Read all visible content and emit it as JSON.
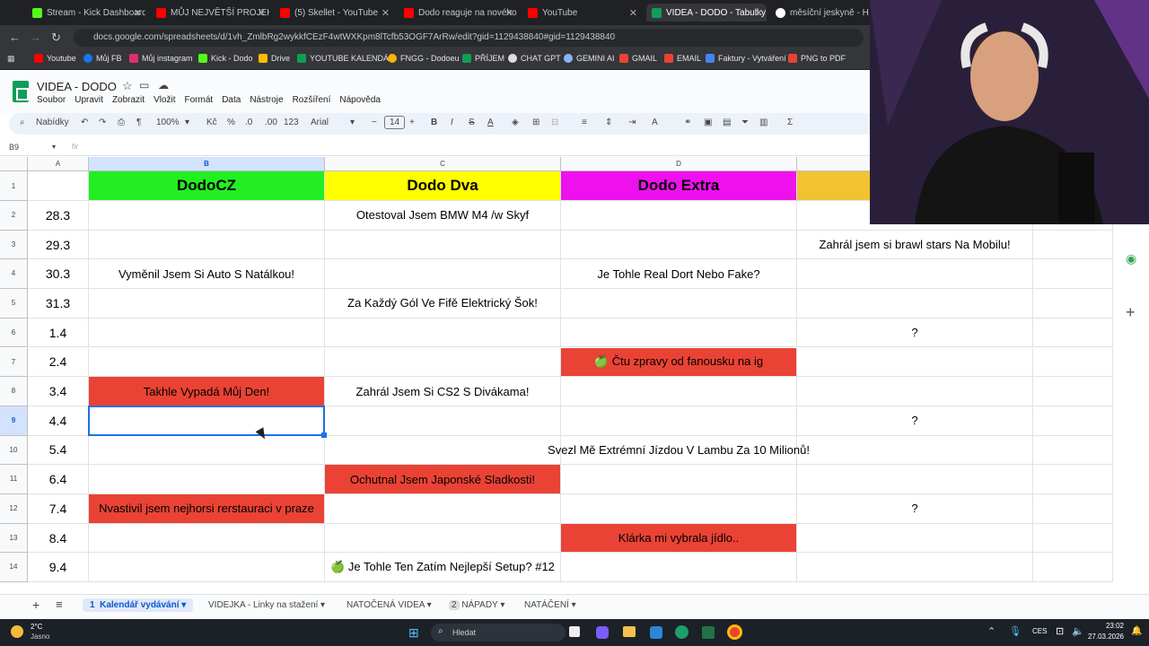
{
  "browser": {
    "tabs": [
      {
        "title": "Stream - Kick Dashboard",
        "color": "#53fc18"
      },
      {
        "title": "MŮJ NEJVĚTŠÍ PROJEKT...",
        "color": "#ff0000"
      },
      {
        "title": "(5) Skellet - YouTube",
        "color": "#ff0000"
      },
      {
        "title": "Dodo reaguje na nového",
        "color": "#ff0000"
      },
      {
        "title": "YouTube",
        "color": "#ff0000"
      },
      {
        "title": "VIDEA - DODO - Tabulky",
        "color": "#0f9d58"
      },
      {
        "title": "měsíční jeskyně - Hledat G",
        "color": "#ffffff"
      }
    ],
    "url": "docs.google.com/spreadsheets/d/1vh_ZmlbRg2wykkfCEzF4wtWXKpm8lTcfb53OGF7ArRw/edit?gid=1129438840#gid=1129438840",
    "bookmarks": [
      "Youtube",
      "Můj FB",
      "Můj instagram",
      "Kick - Dodo",
      "Drive",
      "YOUTUBE KALENDÁŘ",
      "FNGG - Dodoeu",
      "PŘÍJEM",
      "CHAT GPT",
      "GEMINI AI",
      "GMAIL",
      "EMAIL",
      "Faktury - Vytváření",
      "PNG to PDF"
    ]
  },
  "doc": {
    "title": "VIDEA - DODO",
    "menu": [
      "Soubor",
      "Upravit",
      "Zobrazit",
      "Vložit",
      "Formát",
      "Data",
      "Nástroje",
      "Rozšíření",
      "Nápověda"
    ]
  },
  "toolbar": {
    "search_label": "Nabídky",
    "zoom": "100%",
    "currency": "Kč",
    "percent": "%",
    "dec_minus": ".0",
    "dec_plus": ".00",
    "number_format": "123",
    "font": "Arial",
    "font_size": "14"
  },
  "formula_bar": {
    "cell_ref": "B9",
    "fx": "fx"
  },
  "columns": [
    "A",
    "B",
    "C",
    "D"
  ],
  "header_row": {
    "number": "1",
    "b": "DodoCZ",
    "c": "Dodo Dva",
    "d": "Dodo Extra"
  },
  "rows": [
    {
      "n": "2",
      "date": "28.3",
      "b": "",
      "c": "Otestoval Jsem BMW M4 /w Skyf",
      "d": "",
      "e": ""
    },
    {
      "n": "3",
      "date": "29.3",
      "b": "",
      "c": "",
      "d": "",
      "e": "Zahrál jsem si brawl stars Na Mobilu!"
    },
    {
      "n": "4",
      "date": "30.3",
      "b": "Vyměnil Jsem Si Auto S Natálkou!",
      "c": "",
      "d": "Je Tohle Real Dort Nebo Fake?",
      "e": ""
    },
    {
      "n": "5",
      "date": "31.3",
      "b": "",
      "c": "Za Každý Gól Ve Fifě Elektrický Šok!",
      "d": "",
      "e": ""
    },
    {
      "n": "6",
      "date": "1.4",
      "b": "",
      "c": "",
      "d": "",
      "e": "?"
    },
    {
      "n": "7",
      "date": "2.4",
      "b": "",
      "c": "",
      "d": "🍏 Čtu zpravy od fanousku na ig",
      "e": ""
    },
    {
      "n": "8",
      "date": "3.4",
      "b": "Takhle Vypadá Můj Den!",
      "c": "Zahrál Jsem Si CS2 S Divákama!",
      "d": "",
      "e": ""
    },
    {
      "n": "9",
      "date": "4.4",
      "b": "",
      "c": "",
      "d": "",
      "e": "?"
    },
    {
      "n": "10",
      "date": "5.4",
      "b": "",
      "c": "",
      "d": "Svezl Mě Extrémní Jízdou V Lambu Za 10 Milionů!",
      "e": ""
    },
    {
      "n": "11",
      "date": "6.4",
      "b": "",
      "c": "Ochutnal Jsem Japonské Sladkosti!",
      "d": "",
      "e": ""
    },
    {
      "n": "12",
      "date": "7.4",
      "b": "Nvastivil jsem nejhorsi rerstauraci v praze",
      "c": "",
      "d": "",
      "e": "?"
    },
    {
      "n": "13",
      "date": "8.4",
      "b": "",
      "c": "",
      "d": "Klárka mi vybrala jídlo..",
      "e": ""
    },
    {
      "n": "14",
      "date": "9.4",
      "b": "",
      "c": "🍏 Je Tohle Ten Zatím Nejlepší Setup? #12",
      "d": "",
      "e": ""
    }
  ],
  "colors": {
    "green": "#22ee22",
    "yellow": "#ffff00",
    "magenta": "#ee11ee",
    "orange": "#f1c232",
    "red": "#ea4335",
    "selection": "#1a73e8"
  },
  "sheet_tabs": [
    {
      "num": "1",
      "label": "Kalendář vydávání"
    },
    {
      "num": "",
      "label": "VIDEJKA - Linky na stažení"
    },
    {
      "num": "",
      "label": "NATOČENÁ VIDEA"
    },
    {
      "num": "2",
      "label": "NÁPADY"
    },
    {
      "num": "",
      "label": "NATÁČENÍ"
    }
  ],
  "taskbar": {
    "weather_temp": "2°C",
    "weather_desc": "Jasno",
    "search": "Hledat",
    "lang": "CES",
    "time": "23:02",
    "date": "27.03.2026"
  }
}
